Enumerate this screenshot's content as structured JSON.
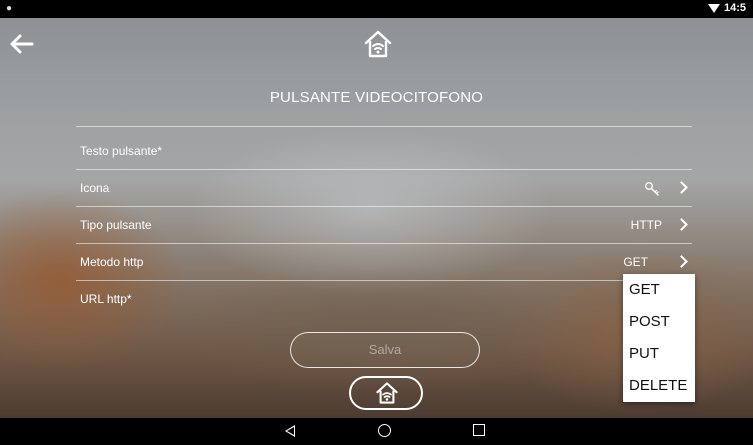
{
  "status_bar": {
    "time": "14:5"
  },
  "header": {
    "title": "PULSANTE VIDEOCITOFONO"
  },
  "form": {
    "rows": [
      {
        "label": "Testo pulsante*",
        "value": ""
      },
      {
        "label": "Icona",
        "value": ""
      },
      {
        "label": "Tipo pulsante",
        "value": "HTTP"
      },
      {
        "label": "Metodo http",
        "value": "GET"
      },
      {
        "label": "URL http*",
        "value": ""
      }
    ],
    "save_label": "Salva"
  },
  "dropdown": {
    "options": [
      "GET",
      "POST",
      "PUT",
      "DELETE"
    ]
  },
  "icons": {
    "back": "arrow-left-icon",
    "logo": "home-wifi-icon",
    "key": "key-icon",
    "chevron": "chevron-right-icon"
  },
  "colors": {
    "text": "#ffffff",
    "dropdown_bg": "#ffffff",
    "dropdown_text": "#111111",
    "status_bar": "#000000"
  }
}
